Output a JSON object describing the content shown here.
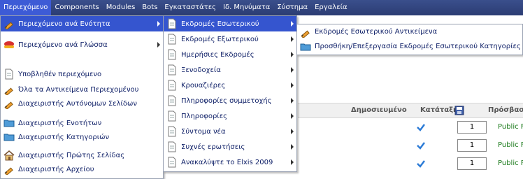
{
  "menubar": {
    "items": [
      {
        "label": "Περιεχόμενο"
      },
      {
        "label": "Components"
      },
      {
        "label": "Modules"
      },
      {
        "label": "Bots"
      },
      {
        "label": "Εγκαταστάτες"
      },
      {
        "label": "Ιδ. Μηνύματα"
      },
      {
        "label": "Σύστημα"
      },
      {
        "label": "Εργαλεία"
      }
    ]
  },
  "menu1": {
    "items": [
      {
        "label": "Περιεχόμενο ανά Ενότητα",
        "icon": "pencil-icon"
      },
      {
        "label": "Περιεχόμενο ανά Γλώσσα",
        "icon": "language-icon"
      },
      {
        "label": "Υποβληθέν περιεχόμενο",
        "icon": "document-icon"
      },
      {
        "label": "Όλα τα Αντικείμενα Περιεχομένου",
        "icon": "pencil-icon"
      },
      {
        "label": "Διαχειριστής Αυτόνομων Σελίδων",
        "icon": "pencil-icon"
      },
      {
        "label": "Διαχειριστής Ενοτήτων",
        "icon": "folder-icon"
      },
      {
        "label": "Διαχειριστής Κατηγοριών",
        "icon": "folder-icon"
      },
      {
        "label": "Διαχειριστής Πρώτης Σελίδας",
        "icon": "home-icon"
      },
      {
        "label": "Διαχειριστής Αρχείου",
        "icon": "pencil-icon"
      }
    ]
  },
  "menu2": {
    "items": [
      {
        "label": "Εκδρομές Εσωτερικού"
      },
      {
        "label": "Εκδρομές Εξωτερικού"
      },
      {
        "label": "Ημερήσιες Εκδρομές"
      },
      {
        "label": "Ξενοδοχεία"
      },
      {
        "label": "Κρουαζιέρες"
      },
      {
        "label": "Πληροφορίες συμμετοχής"
      },
      {
        "label": "Πληροφορίες"
      },
      {
        "label": "Σύντομα νέα"
      },
      {
        "label": "Συχνές ερωτήσεις"
      },
      {
        "label": "Ανακαλύψτε το Elxis 2009"
      }
    ]
  },
  "menu3": {
    "items": [
      {
        "label": "Εκδρομές Εσωτερικού Αντικείμενα",
        "icon": "pencil-icon"
      },
      {
        "label": "Προσθήκη/Επεξεργασία Εκδρομές Εσωτερικού Κατηγορίες",
        "icon": "folder-icon"
      }
    ]
  },
  "table": {
    "headers": {
      "published": "Δημοσιευμένο",
      "order": "Κατάταξη",
      "access": "Πρόσβασ"
    },
    "rows": [
      {
        "order": "1",
        "access": "Public Fronte"
      },
      {
        "order": "1",
        "access": "Public Fronte"
      },
      {
        "order": "1",
        "access": "Public Fronte"
      }
    ]
  },
  "colors": {
    "menubar": "#2b3c73",
    "highlight": "#3555cf",
    "menu_text": "#0d1e66",
    "access_text": "#1b7a1b"
  }
}
